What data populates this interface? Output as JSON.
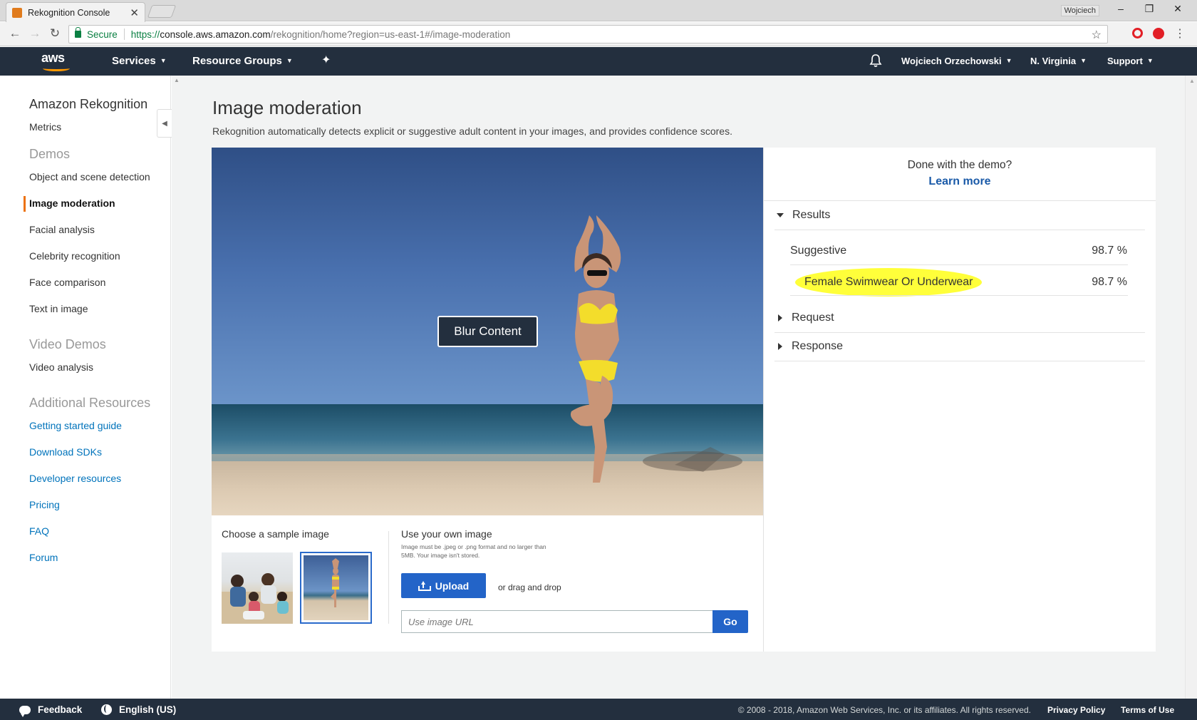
{
  "browser": {
    "tab_title": "Rekognition Console",
    "close_glyph": "✕",
    "window_user": "Wojciech",
    "window_controls": [
      "–",
      "❐",
      "✕"
    ],
    "nav": {
      "back": "←",
      "forward": "→",
      "reload": "↻"
    },
    "secure_label": "Secure",
    "url_proto": "https://",
    "url_host": "console.aws.amazon.com",
    "url_path": "/rekognition/home?region=us-east-1#/image-moderation",
    "star_glyph": "☆",
    "menu_glyph": "⋮"
  },
  "aws_header": {
    "logo": "aws",
    "services": "Services",
    "resource_groups": "Resource Groups",
    "pin_glyph": "✦",
    "caret": "▼",
    "user": "Wojciech Orzechowski",
    "region": "N. Virginia",
    "support": "Support"
  },
  "sidebar": {
    "title": "Amazon Rekognition",
    "metrics": "Metrics",
    "demos_heading": "Demos",
    "demos": [
      "Object and scene detection",
      "Image moderation",
      "Facial analysis",
      "Celebrity recognition",
      "Face comparison",
      "Text in image"
    ],
    "video_heading": "Video Demos",
    "video_items": [
      "Video analysis"
    ],
    "resources_heading": "Additional Resources",
    "resources": [
      "Getting started guide",
      "Download SDKs",
      "Developer resources",
      "Pricing",
      "FAQ",
      "Forum"
    ],
    "collapse_glyph": "◀",
    "scroll_glyph": "▲"
  },
  "main": {
    "title": "Image moderation",
    "description": "Rekognition automatically detects explicit or suggestive adult content in your images, and provides confidence scores.",
    "blur_button": "Blur Content",
    "sample_label": "Choose a sample image",
    "own_label": "Use your own image",
    "own_hint": "Image must be .jpeg or .png format and no larger than 5MB. Your image isn't stored.",
    "upload_button": "Upload",
    "drag_text": "or drag and drop",
    "url_placeholder": "Use image URL",
    "go_button": "Go"
  },
  "results_panel": {
    "done_text": "Done with the demo?",
    "learn_more": "Learn more",
    "results_heading": "Results",
    "results": [
      {
        "label": "Suggestive",
        "value": "98.7 %"
      },
      {
        "label": "Female Swimwear Or Underwear",
        "value": "98.7 %"
      }
    ],
    "request_heading": "Request",
    "response_heading": "Response"
  },
  "footer": {
    "feedback": "Feedback",
    "language": "English (US)",
    "copyright": "© 2008 - 2018, Amazon Web Services, Inc. or its affiliates. All rights reserved.",
    "privacy": "Privacy Policy",
    "terms": "Terms of Use"
  },
  "colors": {
    "aws_nav": "#232f3e",
    "accent_orange": "#ec7211",
    "link_blue": "#0073bb",
    "button_blue": "#2364c8",
    "highlight_yellow": "#ffff3a"
  }
}
